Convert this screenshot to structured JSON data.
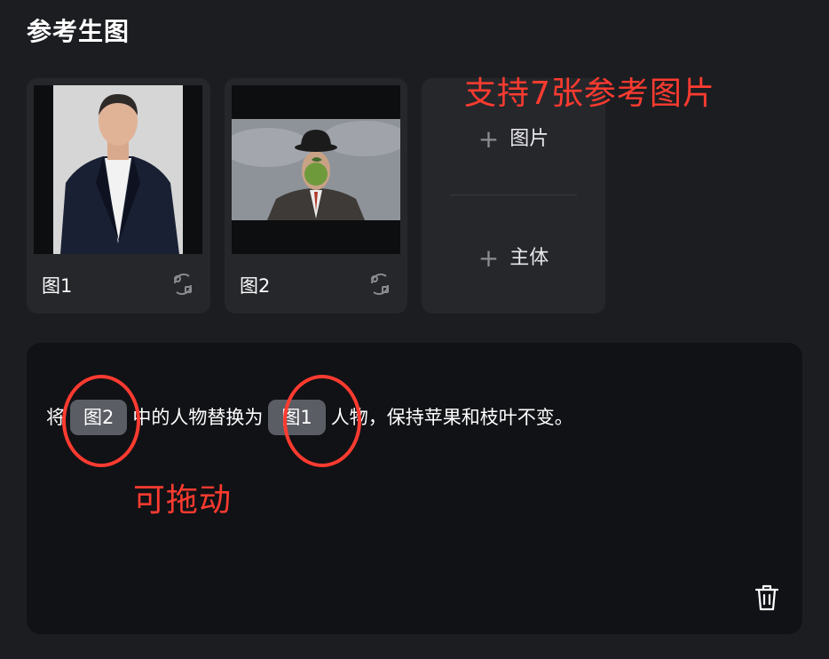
{
  "section": {
    "title": "参考生图"
  },
  "cards": [
    {
      "label": "图1",
      "image": "man-in-suit-photo"
    },
    {
      "label": "图2",
      "image": "man-bowler-hat-apple-painting"
    }
  ],
  "add_panel": {
    "add_image_label": "图片",
    "add_subject_label": "主体"
  },
  "annotations": {
    "top": "支持7张参考图片",
    "drag": "可拖动"
  },
  "prompt": {
    "part1": "将",
    "chip1": "图2",
    "part2": "中的人物替换为",
    "chip2": "图1",
    "part3": "人物，保持苹果和枝叶不变。"
  },
  "colors": {
    "background": "#1c1d21",
    "card": "#26272b",
    "prompt_bg": "#111216",
    "chip": "#5b5d65",
    "annotation": "#ff3b30"
  }
}
